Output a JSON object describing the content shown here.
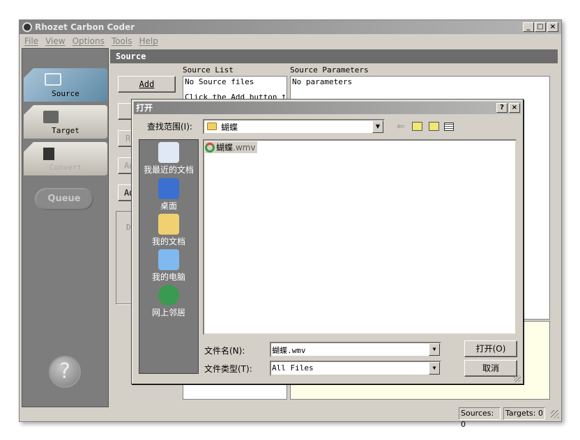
{
  "window": {
    "title": "Rhozet Carbon Coder",
    "controls": [
      "_",
      "□",
      "×"
    ]
  },
  "menu": [
    "File",
    "View",
    "Options",
    "Tools",
    "Help"
  ],
  "nav": {
    "tabs": [
      {
        "label": "Source",
        "active": true
      },
      {
        "label": "Target"
      },
      {
        "label": "Convert"
      }
    ],
    "queue": "Queue",
    "help": "?"
  },
  "main": {
    "header": "Source",
    "add": "Add",
    "r_btn": "R",
    "ad_btn1": "Ad",
    "ad_btn2": "Ad",
    "d_label": "D",
    "source_list": {
      "label": "Source List",
      "line1": "No Source files",
      "line2": "Click the Add button to"
    },
    "source_params": {
      "label": "Source Parameters",
      "text": "No parameters"
    }
  },
  "dialog": {
    "title": "打开",
    "help": "?",
    "close": "×",
    "look_in_label": "查找范围(I):",
    "look_in_value": "蝴蝶",
    "places": [
      "我最近的文档",
      "桌面",
      "我的文档",
      "我的电脑",
      "网上邻居"
    ],
    "files": [
      {
        "name": "蝴蝶",
        "ext": ".wmv"
      }
    ],
    "filename_label": "文件名(N):",
    "filename_value": "蝴蝶.wmv",
    "filetype_label": "文件类型(T):",
    "filetype_value": "All Files",
    "open": "打开(O)",
    "cancel": "取消"
  },
  "status": {
    "sources": "Sources: 0",
    "targets": "Targets: 0"
  }
}
